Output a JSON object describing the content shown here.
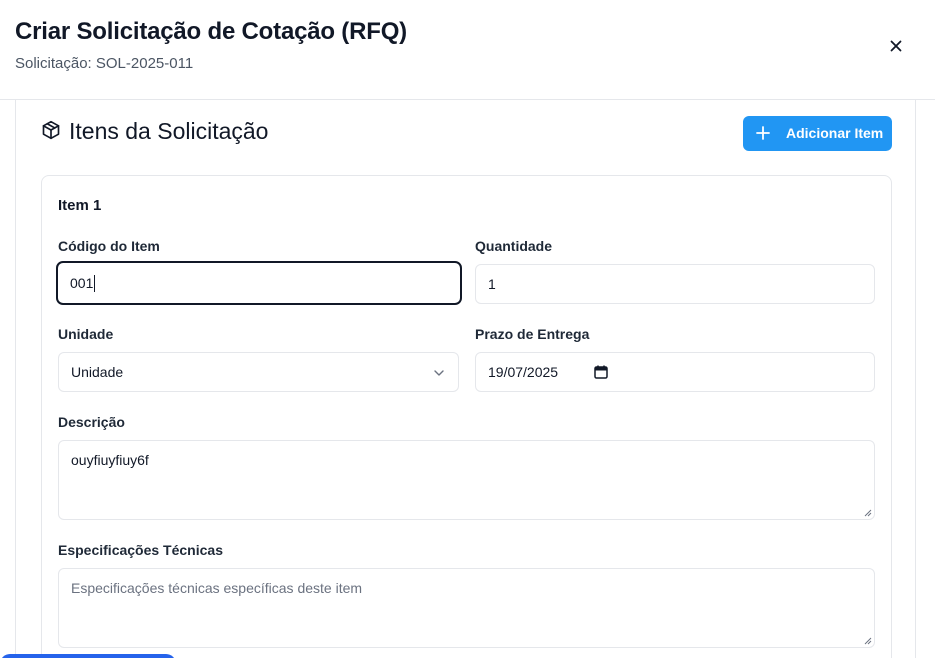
{
  "modal": {
    "title": "Criar Solicitação de Cotação (RFQ)",
    "subtitle": "Solicitação: SOL-2025-011",
    "close_icon": "x-icon"
  },
  "section": {
    "icon": "package-icon",
    "title": "Itens da Solicitação",
    "add_button_label": "Adicionar Item",
    "add_button_icon": "plus-icon",
    "accent_color": "#2196f3"
  },
  "item": {
    "title": "Item 1",
    "code_label": "Código do Item",
    "code_value": "001",
    "quantity_label": "Quantidade",
    "quantity_value": "1",
    "unit_label": "Unidade",
    "unit_value": "Unidade",
    "deadline_label": "Prazo de Entrega",
    "deadline_value": "19/07/2025",
    "description_label": "Descrição",
    "description_value": "ouyfiuyfiuy6f",
    "specs_label": "Especificações Técnicas",
    "specs_placeholder": "Especificações técnicas específicas deste item"
  }
}
